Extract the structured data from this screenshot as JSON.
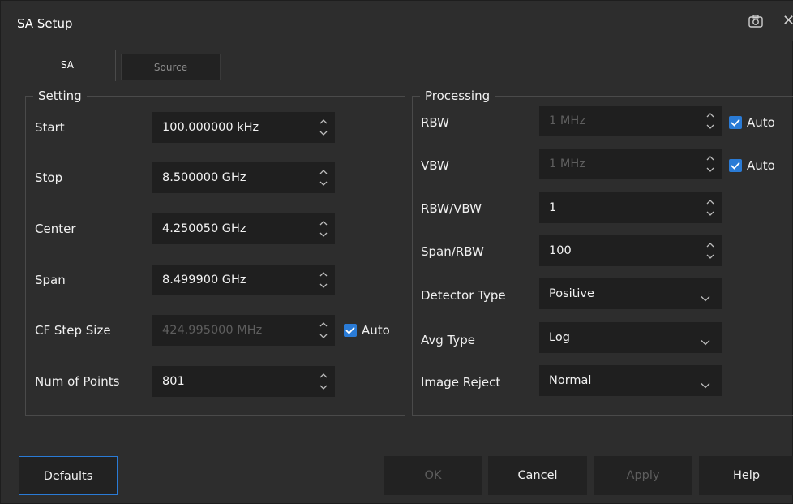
{
  "dialog": {
    "title": "SA Setup"
  },
  "tabs": [
    {
      "label": "SA",
      "active": true
    },
    {
      "label": "Source",
      "active": false
    }
  ],
  "setting": {
    "title": "Setting",
    "rows": [
      {
        "label": "Start",
        "value": "100.000000 kHz",
        "enabled": true
      },
      {
        "label": "Stop",
        "value": "8.500000 GHz",
        "enabled": true
      },
      {
        "label": "Center",
        "value": "4.250050 GHz",
        "enabled": true
      },
      {
        "label": "Span",
        "value": "8.499900 GHz",
        "enabled": true
      },
      {
        "label": "CF Step Size",
        "value": "424.995000 MHz",
        "enabled": false,
        "auto_label": "Auto",
        "auto_checked": true
      },
      {
        "label": "Num of Points",
        "value": "801",
        "enabled": true
      }
    ]
  },
  "processing": {
    "title": "Processing",
    "rows": [
      {
        "label": "RBW",
        "value": "1 MHz",
        "enabled": false,
        "auto_label": "Auto",
        "auto_checked": true
      },
      {
        "label": "VBW",
        "value": "1 MHz",
        "enabled": false,
        "auto_label": "Auto",
        "auto_checked": true
      },
      {
        "label": "RBW/VBW",
        "value": "1",
        "enabled": true
      },
      {
        "label": "Span/RBW",
        "value": "100",
        "enabled": true
      },
      {
        "label": "Detector Type",
        "value": "Positive",
        "type": "dropdown"
      },
      {
        "label": "Avg Type",
        "value": "Log",
        "type": "dropdown"
      },
      {
        "label": "Image Reject",
        "value": "Normal",
        "type": "dropdown"
      }
    ]
  },
  "buttons": {
    "defaults": "Defaults",
    "ok": "OK",
    "cancel": "Cancel",
    "apply": "Apply",
    "help": "Help"
  },
  "icons": {
    "camera": "camera-icon",
    "close": "close-icon",
    "spin": "spin-arrows-icon",
    "dropdown": "chevron-down-icon",
    "check": "checkmark-icon"
  },
  "colors": {
    "accent": "#2a7bd6",
    "background": "#2d2d2d",
    "field": "#1f1f1f"
  }
}
